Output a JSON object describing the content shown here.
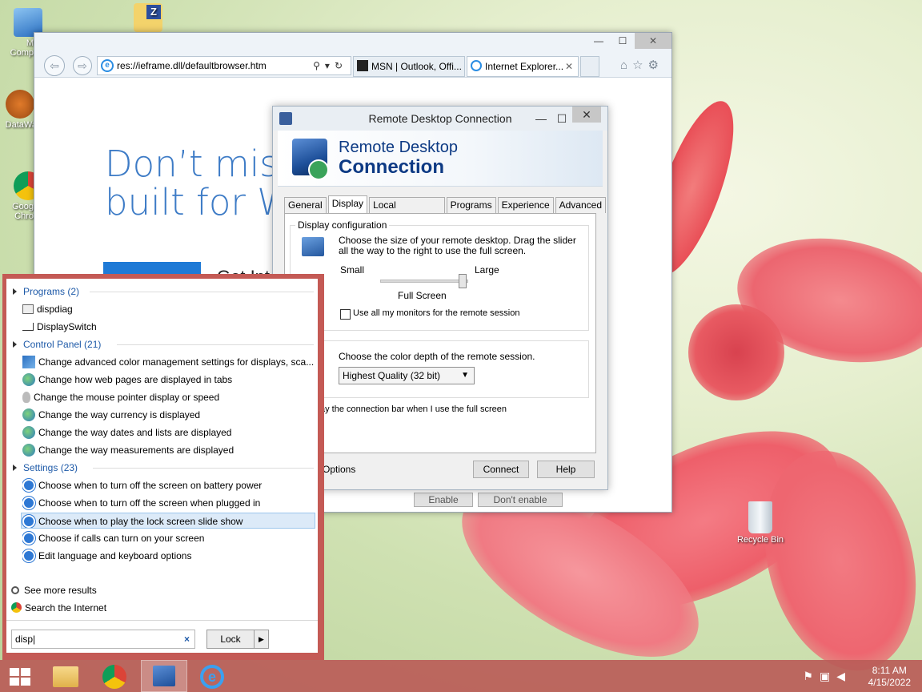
{
  "desktop": {
    "icons": [
      {
        "label": "M\nComp",
        "icon": "computer-icon"
      },
      {
        "label": "",
        "icon": "zip-folder-icon"
      },
      {
        "label": "DataWa",
        "icon": "datawatch-icon"
      },
      {
        "label": "Goog\nChro",
        "icon": "chrome-icon"
      },
      {
        "label": "Recycle Bin",
        "icon": "recycle-bin-icon"
      }
    ]
  },
  "ie": {
    "address": "res://ieframe.dll/defaultbrowser.htm",
    "tabs": [
      {
        "label": "MSN | Outlook, Offi..."
      },
      {
        "label": "Internet Explorer..."
      }
    ],
    "promo_line1": "Don’t miss",
    "promo_line2": "built for W",
    "promo_small": "Get Int",
    "behind_buttons": [
      "Enable",
      "Don't enable"
    ]
  },
  "rdc": {
    "title": "Remote Desktop Connection",
    "banner_line1": "Remote Desktop",
    "banner_line2": "Connection",
    "tabs": [
      "General",
      "Display",
      "Local Resources",
      "Programs",
      "Experience",
      "Advanced"
    ],
    "active_tab": "Display",
    "display_group_title": "Display configuration",
    "display_desc": "Choose the size of your remote desktop. Drag the slider all the way to the right to use the full screen.",
    "slider_small": "Small",
    "slider_large": "Large",
    "slider_value_label": "Full Screen",
    "monitors_checkbox": "Use all my monitors for the remote session",
    "color_desc": "Choose the color depth of the remote session.",
    "color_select": "Highest Quality (32 bit)",
    "conn_bar_text": "ay the connection bar when I use the full screen",
    "options_label": "Options",
    "connect_btn": "Connect",
    "help_btn": "Help"
  },
  "search": {
    "categories": {
      "programs": "Programs (2)",
      "control_panel": "Control Panel (21)",
      "settings": "Settings (23)"
    },
    "programs": [
      "dispdiag",
      "DisplaySwitch"
    ],
    "control_panel": [
      "Change advanced color management settings for displays, sca...",
      "Change how web pages are displayed in tabs",
      "Change the mouse pointer display or speed",
      "Change the way currency is displayed",
      "Change the way dates and lists are displayed",
      "Change the way measurements are displayed"
    ],
    "settings": [
      "Choose when to turn off the screen on battery power",
      "Choose when to turn off the screen when plugged in",
      "Choose when to play the lock screen slide show",
      "Choose if calls can turn on your screen",
      "Edit language and keyboard options"
    ],
    "see_more": "See more results",
    "search_internet": "Search the Internet",
    "query": "disp",
    "lock_label": "Lock"
  },
  "taskbar": {
    "time": "8:11 AM",
    "date": "4/15/2022"
  }
}
